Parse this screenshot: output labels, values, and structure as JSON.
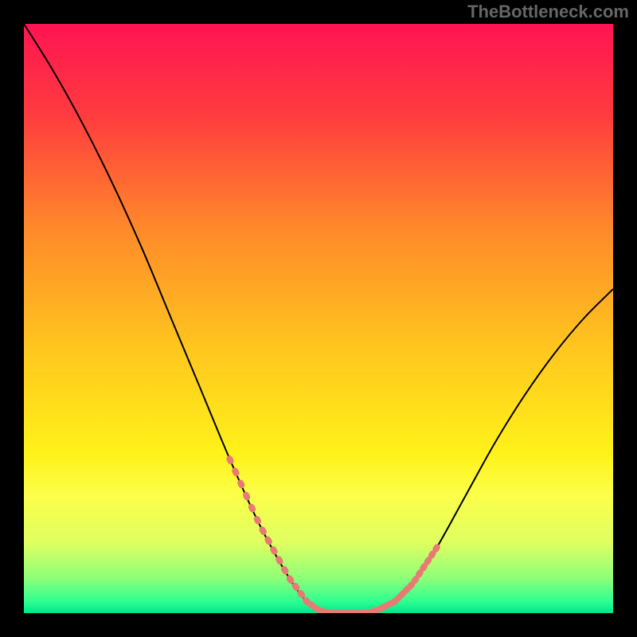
{
  "watermark": "TheBottleneck.com",
  "chart_data": {
    "type": "line",
    "title": "",
    "xlabel": "",
    "ylabel": "",
    "xlim": [
      0,
      100
    ],
    "ylim": [
      0,
      100
    ],
    "background_gradient": {
      "type": "vertical",
      "stops": [
        {
          "pos": 0.0,
          "color": "#ff1453"
        },
        {
          "pos": 0.15,
          "color": "#ff3a3f"
        },
        {
          "pos": 0.35,
          "color": "#ff8a2a"
        },
        {
          "pos": 0.55,
          "color": "#ffc61e"
        },
        {
          "pos": 0.73,
          "color": "#fff21a"
        },
        {
          "pos": 0.8,
          "color": "#fbff4a"
        },
        {
          "pos": 0.88,
          "color": "#dfff60"
        },
        {
          "pos": 0.94,
          "color": "#8eff78"
        },
        {
          "pos": 0.98,
          "color": "#2fff90"
        },
        {
          "pos": 1.0,
          "color": "#00e58c"
        }
      ]
    },
    "series": [
      {
        "name": "bottleneck-curve",
        "color": "#000000",
        "x": [
          0,
          5,
          10,
          15,
          20,
          25,
          30,
          35,
          40,
          45,
          48,
          50,
          52,
          55,
          58,
          60,
          63,
          66,
          70,
          75,
          80,
          85,
          90,
          95,
          100
        ],
        "y": [
          100,
          92,
          83,
          73,
          62,
          50,
          38,
          26,
          15,
          6,
          2,
          0.5,
          0,
          0,
          0,
          0.5,
          2,
          5,
          11,
          20,
          29,
          37,
          44,
          50,
          55
        ]
      }
    ],
    "highlight_segments": [
      {
        "name": "left-valley-markers",
        "color": "#e87a74",
        "x_range": [
          35,
          48
        ],
        "style": "dotted-thick"
      },
      {
        "name": "right-valley-markers",
        "color": "#e87a74",
        "x_range": [
          60,
          70
        ],
        "style": "dotted-thick"
      },
      {
        "name": "bottom-flat-markers",
        "color": "#e87a74",
        "x_range": [
          48,
          60
        ],
        "style": "dotted-thick"
      }
    ]
  }
}
